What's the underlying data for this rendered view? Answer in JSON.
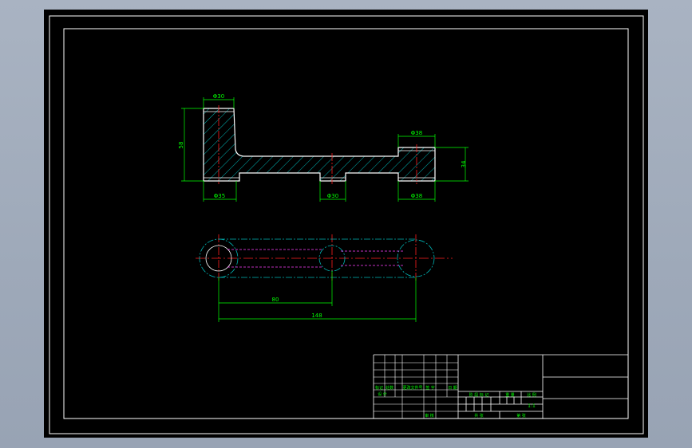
{
  "colors": {
    "sheet_bg": "#000000",
    "frame": "#ffffff",
    "outline": "#ffffff",
    "hatch": "#00c8c8",
    "centerline": "#ff2020",
    "dimension": "#00ff00",
    "hidden": "#ff40ff",
    "construction": "#00b4b4",
    "title_text": "#00ff00"
  },
  "section_view": {
    "dims": {
      "d_top_left": "Φ30",
      "height_left": "58",
      "d_top_right": "Φ38",
      "height_right": "34",
      "d_bottom_left": "Φ35",
      "d_bottom_mid": "Φ30",
      "d_bottom_right": "Φ38"
    }
  },
  "plan_view": {
    "dims": {
      "dist_small": "80",
      "dist_total": "148"
    }
  },
  "title_block": {
    "revision_row": [
      "标记",
      "处数",
      "更改文件号",
      "签 字",
      "日 期"
    ],
    "design_row": "设 计",
    "stage_header": [
      "阶 段 标 记",
      "重 量",
      "比 例"
    ],
    "scale": "1:1",
    "approve": "审 核",
    "sheet_total": "共  张",
    "sheet_no": "第  张"
  }
}
